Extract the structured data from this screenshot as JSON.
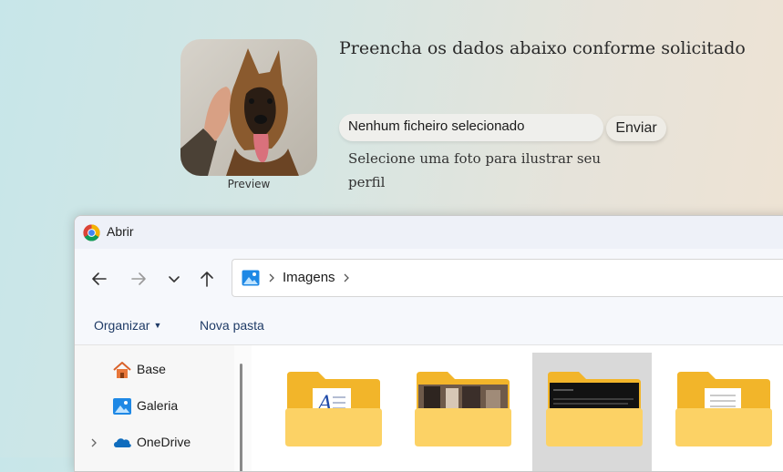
{
  "preview": {
    "label": "Preview"
  },
  "form": {
    "title": "Preencha os dados abaixo conforme solicitado",
    "file_status": "Nenhum ficheiro selecionado",
    "submit_label": "Enviar",
    "hint": "Selecione uma foto para ilustrar seu perfil"
  },
  "dialog": {
    "title": "Abrir",
    "nav": {
      "back_icon": "arrow-left-icon",
      "forward_icon": "arrow-right-icon",
      "recent_icon": "chevron-down-icon",
      "up_icon": "arrow-up-icon"
    },
    "breadcrumb": {
      "icon": "pictures-icon",
      "current": "Imagens"
    },
    "commands": {
      "organize": "Organizar",
      "new_folder": "Nova pasta"
    },
    "sidebar": [
      {
        "label": "Base",
        "icon": "home-icon",
        "expandable": false
      },
      {
        "label": "Galeria",
        "icon": "gallery-icon",
        "expandable": false
      },
      {
        "label": "OneDrive",
        "icon": "cloud-icon",
        "expandable": true
      }
    ],
    "folders": [
      {
        "kind": "document-font",
        "selected": false
      },
      {
        "kind": "photo-people",
        "selected": false
      },
      {
        "kind": "dark-screenshot",
        "selected": true
      },
      {
        "kind": "document-page",
        "selected": false
      }
    ]
  },
  "colors": {
    "folder_back": "#f2b52a",
    "folder_front": "#fcd265",
    "selected_bg": "#d9d9d9",
    "link_blue": "#1f3b66"
  }
}
